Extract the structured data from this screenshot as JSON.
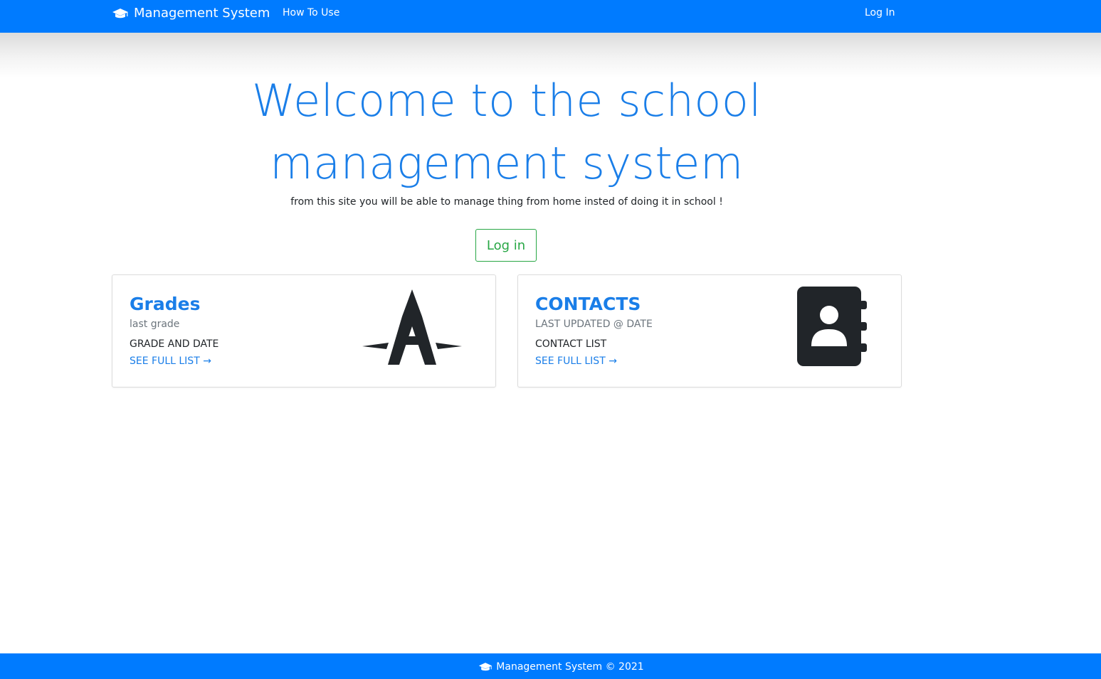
{
  "navbar": {
    "brand": "Management System",
    "brand_icon": "graduation-cap-icon",
    "how_to_use": "How To Use",
    "login": "Log In",
    "color": "#007bff"
  },
  "hero": {
    "title": "Welcome to the school management system",
    "subtitle": "from this site you will be able to manage thing from home insted of doing it in school !",
    "login_button": "Log in",
    "title_color": "#1a7ee8",
    "button_color": "#28a745"
  },
  "cards": [
    {
      "title": "Grades",
      "subtitle": "last grade",
      "text": "GRADE AND DATE",
      "link": "SEE FULL LIST →",
      "icon": "grade-a-icon"
    },
    {
      "title": "CONTACTS",
      "subtitle": "LAST UPDATED @ DATE",
      "text": "CONTACT LIST",
      "link": "SEE FULL LIST →",
      "icon": "address-book-icon"
    }
  ],
  "footer": {
    "text": "Management System © 2021",
    "icon": "graduation-cap-icon"
  }
}
